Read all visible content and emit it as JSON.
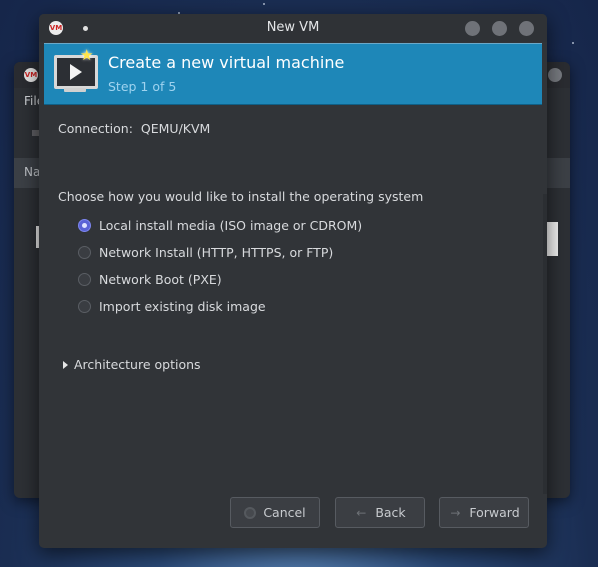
{
  "background_window": {
    "menu_fragment": "File",
    "header_fragment": "Na"
  },
  "dialog": {
    "title": "New VM",
    "banner": {
      "heading": "Create a new virtual machine",
      "step": "Step 1 of 5"
    },
    "connection": {
      "label": "Connection:",
      "value": "QEMU/KVM"
    },
    "install_prompt": "Choose how you would like to install the operating system",
    "install_options": [
      {
        "label": "Local install media (ISO image or CDROM)",
        "selected": true
      },
      {
        "label": "Network Install (HTTP, HTTPS, or FTP)",
        "selected": false
      },
      {
        "label": "Network Boot (PXE)",
        "selected": false
      },
      {
        "label": "Import existing disk image",
        "selected": false
      }
    ],
    "architecture_expander": "Architecture options",
    "buttons": {
      "cancel": "Cancel",
      "back": "Back",
      "forward": "Forward"
    }
  },
  "colors": {
    "banner": "#1e87b8",
    "dialog_bg": "#313438",
    "radio_selected": "#5a63d6"
  }
}
